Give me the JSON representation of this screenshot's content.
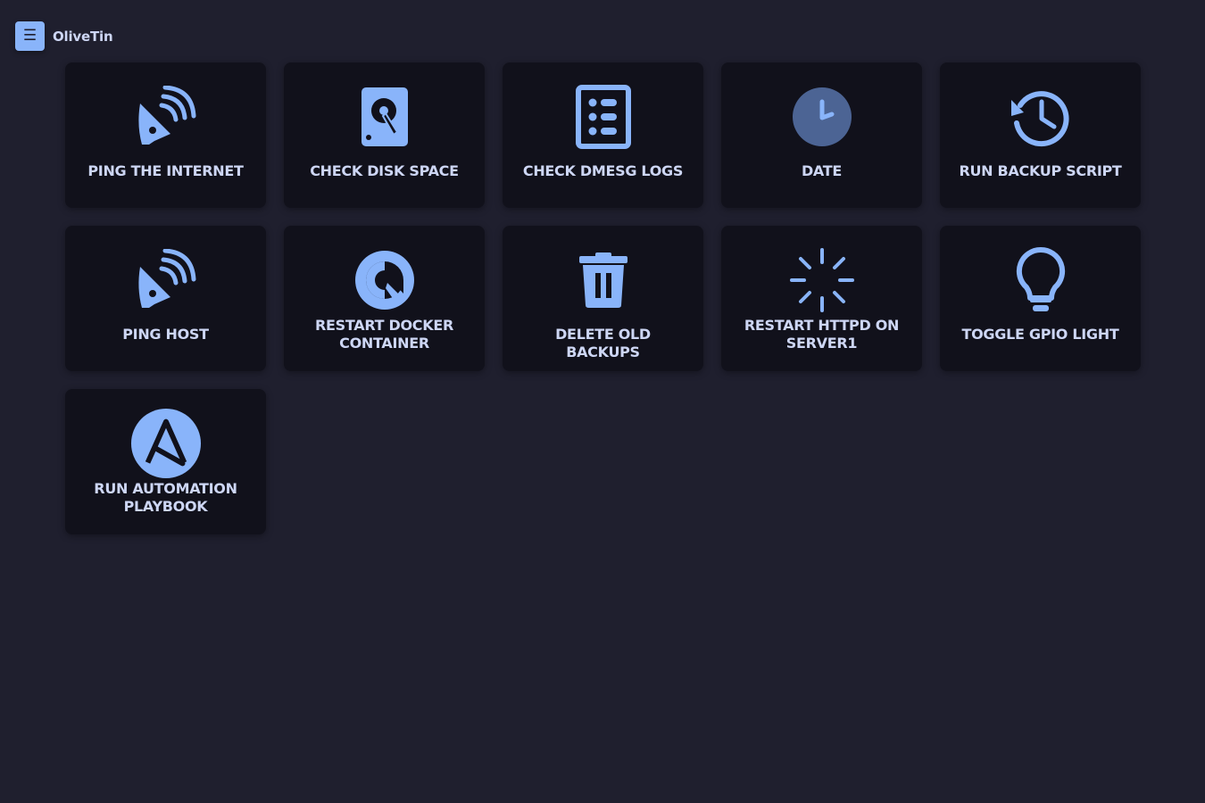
{
  "app": {
    "menu_icon": "hamburger-icon",
    "menu_glyph": "☰",
    "title": "OliveTin"
  },
  "colors": {
    "background": "#1f1f2e",
    "card": "#11111b",
    "accent": "#89b4fa",
    "date_icon": "#4c6494",
    "text": "#cdd6f4"
  },
  "actions": [
    {
      "label": "PING THE INTERNET",
      "icon": "satellite-dish-icon"
    },
    {
      "label": "CHECK DISK SPACE",
      "icon": "hard-drive-icon"
    },
    {
      "label": "CHECK DMESG LOGS",
      "icon": "log-list-icon"
    },
    {
      "label": "DATE",
      "icon": "clock-icon"
    },
    {
      "label": "RUN BACKUP SCRIPT",
      "icon": "history-icon"
    },
    {
      "label": "PING HOST",
      "icon": "satellite-dish-icon"
    },
    {
      "label": "RESTART DOCKER CONTAINER",
      "icon": "restart-icon"
    },
    {
      "label": "DELETE OLD BACKUPS",
      "icon": "trash-icon"
    },
    {
      "label": "RESTART HTTPD ON SERVER1",
      "icon": "spinner-icon"
    },
    {
      "label": "TOGGLE GPIO LIGHT",
      "icon": "lightbulb-icon"
    },
    {
      "label": "RUN AUTOMATION PLAYBOOK",
      "icon": "ansible-icon"
    }
  ]
}
